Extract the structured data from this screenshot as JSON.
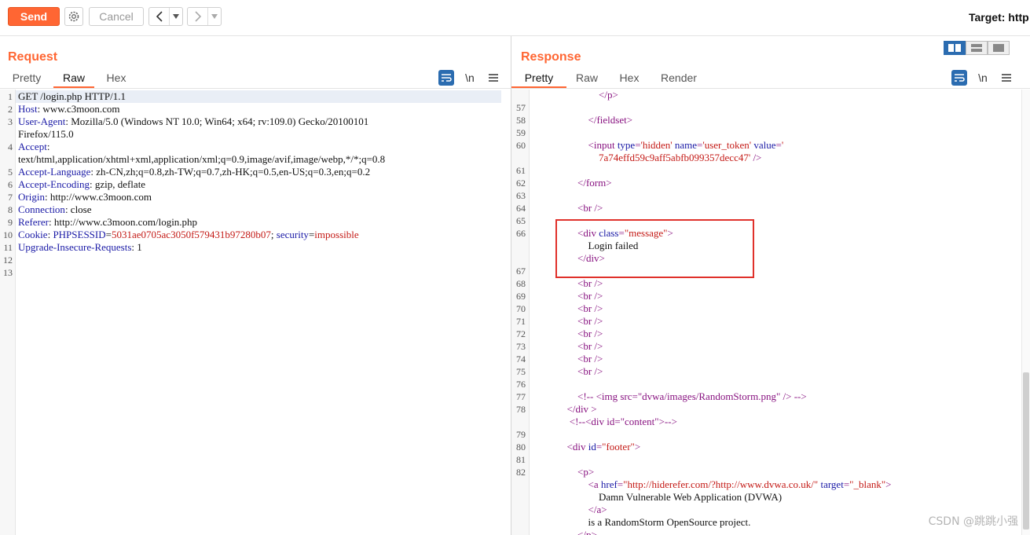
{
  "toolbar": {
    "send_label": "Send",
    "cancel_label": "Cancel",
    "target_label": "Target: http"
  },
  "request": {
    "title": "Request",
    "tabs": [
      "Pretty",
      "Raw",
      "Hex"
    ],
    "active_tab": "Raw",
    "lines": [
      {
        "n": "1",
        "parts": [
          [
            "GET /login.php HTTP/1.1",
            "p"
          ]
        ]
      },
      {
        "n": "2",
        "parts": [
          [
            "Host",
            "k"
          ],
          [
            ": www.c3moon.com",
            "p"
          ]
        ]
      },
      {
        "n": "3",
        "parts": [
          [
            "User-Agent",
            "k"
          ],
          [
            ": Mozilla/5.0 (Windows NT 10.0; Win64; x64; rv:109.0) Gecko/20100101",
            "p"
          ]
        ]
      },
      {
        "n": "",
        "parts": [
          [
            "Firefox/115.0",
            "p"
          ]
        ]
      },
      {
        "n": "4",
        "parts": [
          [
            "Accept",
            "k"
          ],
          [
            ":",
            "p"
          ]
        ]
      },
      {
        "n": "",
        "parts": [
          [
            "text/html,application/xhtml+xml,application/xml;q=0.9,image/avif,image/webp,*/*;q=0.8",
            "p"
          ]
        ]
      },
      {
        "n": "5",
        "parts": [
          [
            "Accept-Language",
            "k"
          ],
          [
            ": zh-CN,zh;q=0.8,zh-TW;q=0.7,zh-HK;q=0.5,en-US;q=0.3,en;q=0.2",
            "p"
          ]
        ]
      },
      {
        "n": "6",
        "parts": [
          [
            "Accept-Encoding",
            "k"
          ],
          [
            ": gzip, deflate",
            "p"
          ]
        ]
      },
      {
        "n": "7",
        "parts": [
          [
            "Origin",
            "k"
          ],
          [
            ": http://www.c3moon.com",
            "p"
          ]
        ]
      },
      {
        "n": "8",
        "parts": [
          [
            "Connection",
            "k"
          ],
          [
            ": close",
            "p"
          ]
        ]
      },
      {
        "n": "9",
        "parts": [
          [
            "Referer",
            "k"
          ],
          [
            ": http://www.c3moon.com/login.php",
            "p"
          ]
        ]
      },
      {
        "n": "10",
        "parts": [
          [
            "Cookie",
            "k"
          ],
          [
            ": ",
            "p"
          ],
          [
            "PHPSESSID",
            "k"
          ],
          [
            "=",
            "p"
          ],
          [
            "5031ae0705ac3050f579431b97280b07",
            "v"
          ],
          [
            "; ",
            "p"
          ],
          [
            "security",
            "k"
          ],
          [
            "=",
            "p"
          ],
          [
            "impossible",
            "v"
          ]
        ]
      },
      {
        "n": "11",
        "parts": [
          [
            "Upgrade-Insecure-Requests",
            "k"
          ],
          [
            ": 1",
            "p"
          ]
        ]
      },
      {
        "n": "12",
        "parts": []
      },
      {
        "n": "13",
        "parts": []
      }
    ]
  },
  "response": {
    "title": "Response",
    "tabs": [
      "Pretty",
      "Raw",
      "Hex",
      "Render"
    ],
    "active_tab": "Pretty",
    "lines": [
      {
        "n": "",
        "ind": 6,
        "parts": [
          [
            "</p>",
            "t"
          ]
        ]
      },
      {
        "n": "57",
        "ind": 0,
        "parts": []
      },
      {
        "n": "58",
        "ind": 5,
        "parts": [
          [
            "</fieldset>",
            "t"
          ]
        ]
      },
      {
        "n": "59",
        "ind": 0,
        "parts": []
      },
      {
        "n": "60",
        "ind": 5,
        "parts": [
          [
            "<input ",
            "t"
          ],
          [
            "type",
            "a"
          ],
          [
            "=",
            "t"
          ],
          [
            "'hidden'",
            "v"
          ],
          [
            " ",
            "p"
          ],
          [
            "name",
            "a"
          ],
          [
            "=",
            "t"
          ],
          [
            "'user_token'",
            "v"
          ],
          [
            " ",
            "p"
          ],
          [
            "value",
            "a"
          ],
          [
            "=",
            "t"
          ],
          [
            "'",
            "v"
          ]
        ]
      },
      {
        "n": "",
        "ind": 6,
        "parts": [
          [
            "7a74effd59c9aff5abfb099357decc47'",
            "v"
          ],
          [
            " />",
            "t"
          ]
        ]
      },
      {
        "n": "61",
        "ind": 0,
        "parts": []
      },
      {
        "n": "62",
        "ind": 4,
        "parts": [
          [
            "</form>",
            "t"
          ]
        ]
      },
      {
        "n": "63",
        "ind": 0,
        "parts": []
      },
      {
        "n": "64",
        "ind": 4,
        "parts": [
          [
            "<br />",
            "t"
          ]
        ]
      },
      {
        "n": "65",
        "ind": 0,
        "parts": []
      },
      {
        "n": "66",
        "ind": 4,
        "parts": [
          [
            "<div ",
            "t"
          ],
          [
            "class",
            "a"
          ],
          [
            "=",
            "t"
          ],
          [
            "\"message\"",
            "v"
          ],
          [
            ">",
            "t"
          ]
        ]
      },
      {
        "n": "",
        "ind": 5,
        "parts": [
          [
            "Login failed",
            "p"
          ]
        ]
      },
      {
        "n": "",
        "ind": 4,
        "parts": [
          [
            "</div>",
            "t"
          ]
        ]
      },
      {
        "n": "67",
        "ind": 0,
        "parts": []
      },
      {
        "n": "68",
        "ind": 4,
        "parts": [
          [
            "<br />",
            "t"
          ]
        ]
      },
      {
        "n": "69",
        "ind": 4,
        "parts": [
          [
            "<br />",
            "t"
          ]
        ]
      },
      {
        "n": "70",
        "ind": 4,
        "parts": [
          [
            "<br />",
            "t"
          ]
        ]
      },
      {
        "n": "71",
        "ind": 4,
        "parts": [
          [
            "<br />",
            "t"
          ]
        ]
      },
      {
        "n": "72",
        "ind": 4,
        "parts": [
          [
            "<br />",
            "t"
          ]
        ]
      },
      {
        "n": "73",
        "ind": 4,
        "parts": [
          [
            "<br />",
            "t"
          ]
        ]
      },
      {
        "n": "74",
        "ind": 4,
        "parts": [
          [
            "<br />",
            "t"
          ]
        ]
      },
      {
        "n": "75",
        "ind": 4,
        "parts": [
          [
            "<br />",
            "t"
          ]
        ]
      },
      {
        "n": "76",
        "ind": 0,
        "parts": []
      },
      {
        "n": "77",
        "ind": 4,
        "parts": [
          [
            "<!-- <img src=\"dvwa/images/RandomStorm.png\" /> -->",
            "t"
          ]
        ]
      },
      {
        "n": "78",
        "ind": 3,
        "parts": [
          [
            "</div >",
            "t"
          ]
        ]
      },
      {
        "n": "",
        "ind": 3,
        "parts": [
          [
            " <!--<div id=\"content\">-->",
            "t"
          ]
        ]
      },
      {
        "n": "79",
        "ind": 0,
        "parts": []
      },
      {
        "n": "80",
        "ind": 3,
        "parts": [
          [
            "<div ",
            "t"
          ],
          [
            "id",
            "a"
          ],
          [
            "=",
            "t"
          ],
          [
            "\"footer\"",
            "v"
          ],
          [
            ">",
            "t"
          ]
        ]
      },
      {
        "n": "81",
        "ind": 0,
        "parts": []
      },
      {
        "n": "82",
        "ind": 4,
        "parts": [
          [
            "<p>",
            "t"
          ]
        ]
      },
      {
        "n": "",
        "ind": 5,
        "parts": [
          [
            "<a ",
            "t"
          ],
          [
            "href",
            "a"
          ],
          [
            "=",
            "t"
          ],
          [
            "\"http://hiderefer.com/?http://www.dvwa.co.uk/\"",
            "v"
          ],
          [
            " ",
            "p"
          ],
          [
            "target",
            "a"
          ],
          [
            "=",
            "t"
          ],
          [
            "\"_blank\"",
            "v"
          ],
          [
            ">",
            "t"
          ]
        ]
      },
      {
        "n": "",
        "ind": 6,
        "parts": [
          [
            "Damn Vulnerable Web Application (DVWA)",
            "p"
          ]
        ]
      },
      {
        "n": "",
        "ind": 5,
        "parts": [
          [
            "</a>",
            "t"
          ]
        ]
      },
      {
        "n": "",
        "ind": 5,
        "parts": [
          [
            "is a RandomStorm OpenSource project.",
            "p"
          ]
        ]
      },
      {
        "n": "",
        "ind": 4,
        "parts": [
          [
            "</p>",
            "t"
          ]
        ]
      }
    ]
  },
  "watermark": "CSDN @跳跳小强",
  "colors": {
    "accent": "#ff6633",
    "tab_icon": "#2b6cb0",
    "highlight_box": "#e0312b"
  }
}
